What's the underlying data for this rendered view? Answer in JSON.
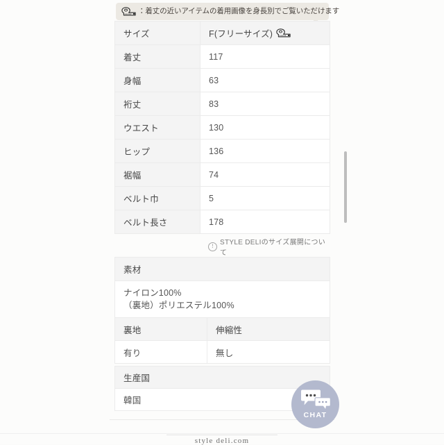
{
  "tooltip": {
    "icon": "measuring-tape-icon",
    "text": "：着丈の近いアイテムの着用画像を身長別でご覧いただけます"
  },
  "size_table": {
    "header": {
      "label": "サイズ",
      "value": "F(フリーサイズ)",
      "icon": "measuring-tape-icon"
    },
    "rows": [
      {
        "label": "着丈",
        "value": "117"
      },
      {
        "label": "身幅",
        "value": "63"
      },
      {
        "label": "裄丈",
        "value": "83"
      },
      {
        "label": "ウエスト",
        "value": "130"
      },
      {
        "label": "ヒップ",
        "value": "136"
      },
      {
        "label": "裾幅",
        "value": "74"
      },
      {
        "label": "ベルト巾",
        "value": "5"
      },
      {
        "label": "ベルト長さ",
        "value": "178"
      }
    ]
  },
  "size_note": {
    "icon": "info-icon",
    "text": "STYLE DELIのサイズ展開について"
  },
  "material_table": {
    "header": "素材",
    "composition_line1": "ナイロン100%",
    "composition_line2": "（裏地）ポリエステル100%",
    "sub_headers": {
      "lining": "裏地",
      "stretch": "伸縮性"
    },
    "sub_values": {
      "lining": "有り",
      "stretch": "無し"
    }
  },
  "country_table": {
    "header": "生産国",
    "value": "韓国"
  },
  "chat_widget": {
    "label": "CHAT",
    "icon": "chat-bubbles-icon"
  },
  "footer": {
    "logo_text": "style deli.com"
  },
  "colors": {
    "page_background": "#fcfcfb",
    "tooltip_background": "#ece9e3",
    "table_header_background": "#f4f4f4",
    "table_border": "#ebebeb",
    "chat_accent": "#b3b9ce",
    "scrollbar_thumb": "#bdbdbd"
  }
}
